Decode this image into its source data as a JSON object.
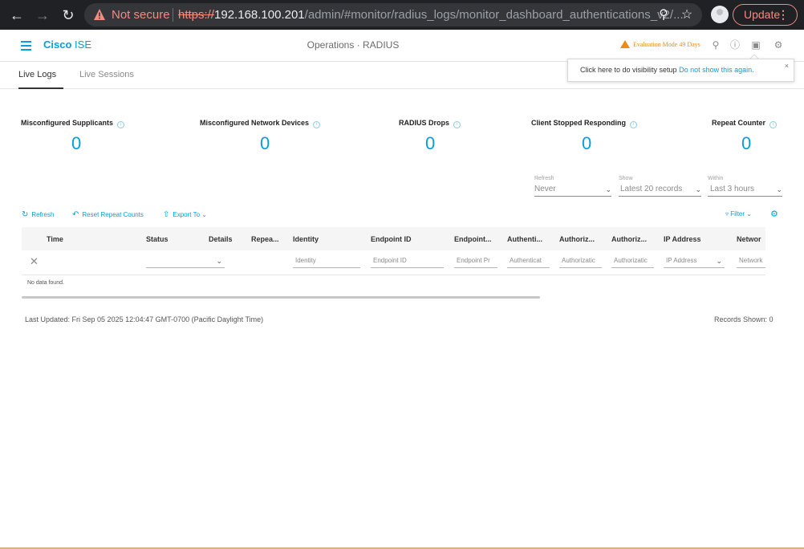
{
  "browser": {
    "security_label": "Not secure",
    "url_protocol": "https://",
    "url_host": "192.168.100.201",
    "url_path": "/admin/#monitor/radius_logs/monitor_dashboard_authentications_v2/...",
    "update_label": "Update",
    "icons": [
      "back-arrow",
      "forward-arrow",
      "reload",
      "warning-triangle",
      "zoom",
      "star",
      "profile",
      "kebab-menu"
    ]
  },
  "header": {
    "brand_bold": "Cisco",
    "brand_light": "ISE",
    "title": "Operations · RADIUS",
    "evaluation_label": "Evaluation Mode 49 Days",
    "icons": [
      "search-icon",
      "help-icon",
      "dashboard-icon",
      "gear-icon"
    ]
  },
  "tooltip": {
    "text": "Click here to do visibility setup",
    "link": "Do not show this again.",
    "close": "×"
  },
  "tabs": [
    {
      "label": "Live Logs",
      "active": true
    },
    {
      "label": "Live Sessions",
      "active": false
    }
  ],
  "counters": [
    {
      "label": "Misconfigured Supplicants",
      "value": "0"
    },
    {
      "label": "Misconfigured Network Devices",
      "value": "0"
    },
    {
      "label": "RADIUS Drops",
      "value": "0"
    },
    {
      "label": "Client Stopped Responding",
      "value": "0"
    },
    {
      "label": "Repeat Counter",
      "value": "0"
    }
  ],
  "filters": {
    "refresh": {
      "label": "Refresh",
      "value": "Never"
    },
    "show": {
      "label": "Show",
      "value": "Latest 20 records"
    },
    "within": {
      "label": "Within",
      "value": "Last 3 hours"
    }
  },
  "toolbar": {
    "refresh": "Refresh",
    "reset": "Reset Repeat Counts",
    "export": "Export To",
    "filter": "Filter"
  },
  "table": {
    "columns": [
      "Time",
      "Status",
      "Details",
      "Repea...",
      "Identity",
      "Endpoint ID",
      "Endpoint...",
      "Authenti...",
      "Authoriz...",
      "Authoriz...",
      "IP Address",
      "Networ"
    ],
    "filter_placeholders": [
      "Identity",
      "Endpoint ID",
      "Endpoint Pr",
      "Authenticat",
      "Authorizatic",
      "Authorizatic",
      "IP Address",
      "Network"
    ],
    "empty_message": "No data found."
  },
  "footer": {
    "last_updated": "Last Updated: Fri Sep 05 2025 12:04:47 GMT-0700 (Pacific Daylight Time)",
    "records_shown": "Records Shown: 0"
  },
  "colors": {
    "accent": "#049fd9",
    "warning": "#ec8c16",
    "chrome_bg": "#202124",
    "insecure": "#f28b82"
  }
}
